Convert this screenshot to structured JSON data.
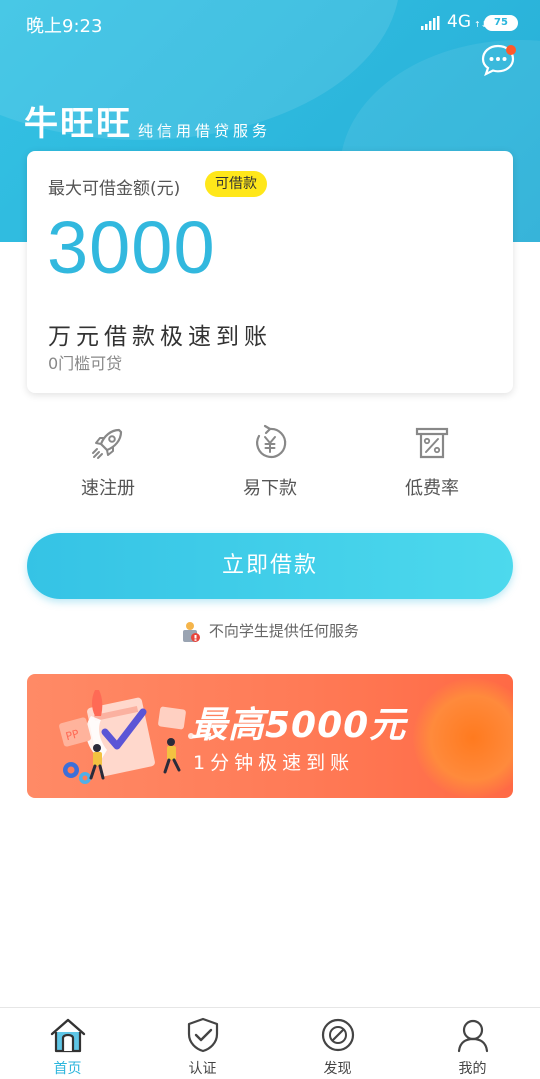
{
  "status_bar": {
    "time": "晚上9:23",
    "network": "4G",
    "network_sub": "↑↓",
    "battery": "75"
  },
  "header": {
    "logo": "牛旺旺",
    "slogan": "纯信用借贷服务"
  },
  "card": {
    "label": "最大可借金额(元)",
    "badge": "可借款",
    "amount": "3000",
    "tagline": "万元借款极速到账",
    "sub": "0门槛可贷"
  },
  "features": [
    {
      "label": "速注册",
      "icon": "rocket-icon"
    },
    {
      "label": "易下款",
      "icon": "yuan-cycle-icon"
    },
    {
      "label": "低费率",
      "icon": "percent-receipt-icon"
    }
  ],
  "main_button": {
    "label": "立即借款"
  },
  "notice": {
    "text": "不向学生提供任何服务"
  },
  "banner": {
    "title": "最高5000元",
    "subtitle": "1分钟极速到账"
  },
  "tabs": [
    {
      "label": "首页",
      "icon": "home-icon",
      "active": true
    },
    {
      "label": "认证",
      "icon": "shield-icon",
      "active": false
    },
    {
      "label": "发现",
      "icon": "compass-icon",
      "active": false
    },
    {
      "label": "我的",
      "icon": "user-icon",
      "active": false
    }
  ],
  "colors": {
    "primary": "#2cb6dc",
    "badge": "#ffe71a",
    "banner": "#ff7b57",
    "alert_dot": "#ff5a2b"
  }
}
